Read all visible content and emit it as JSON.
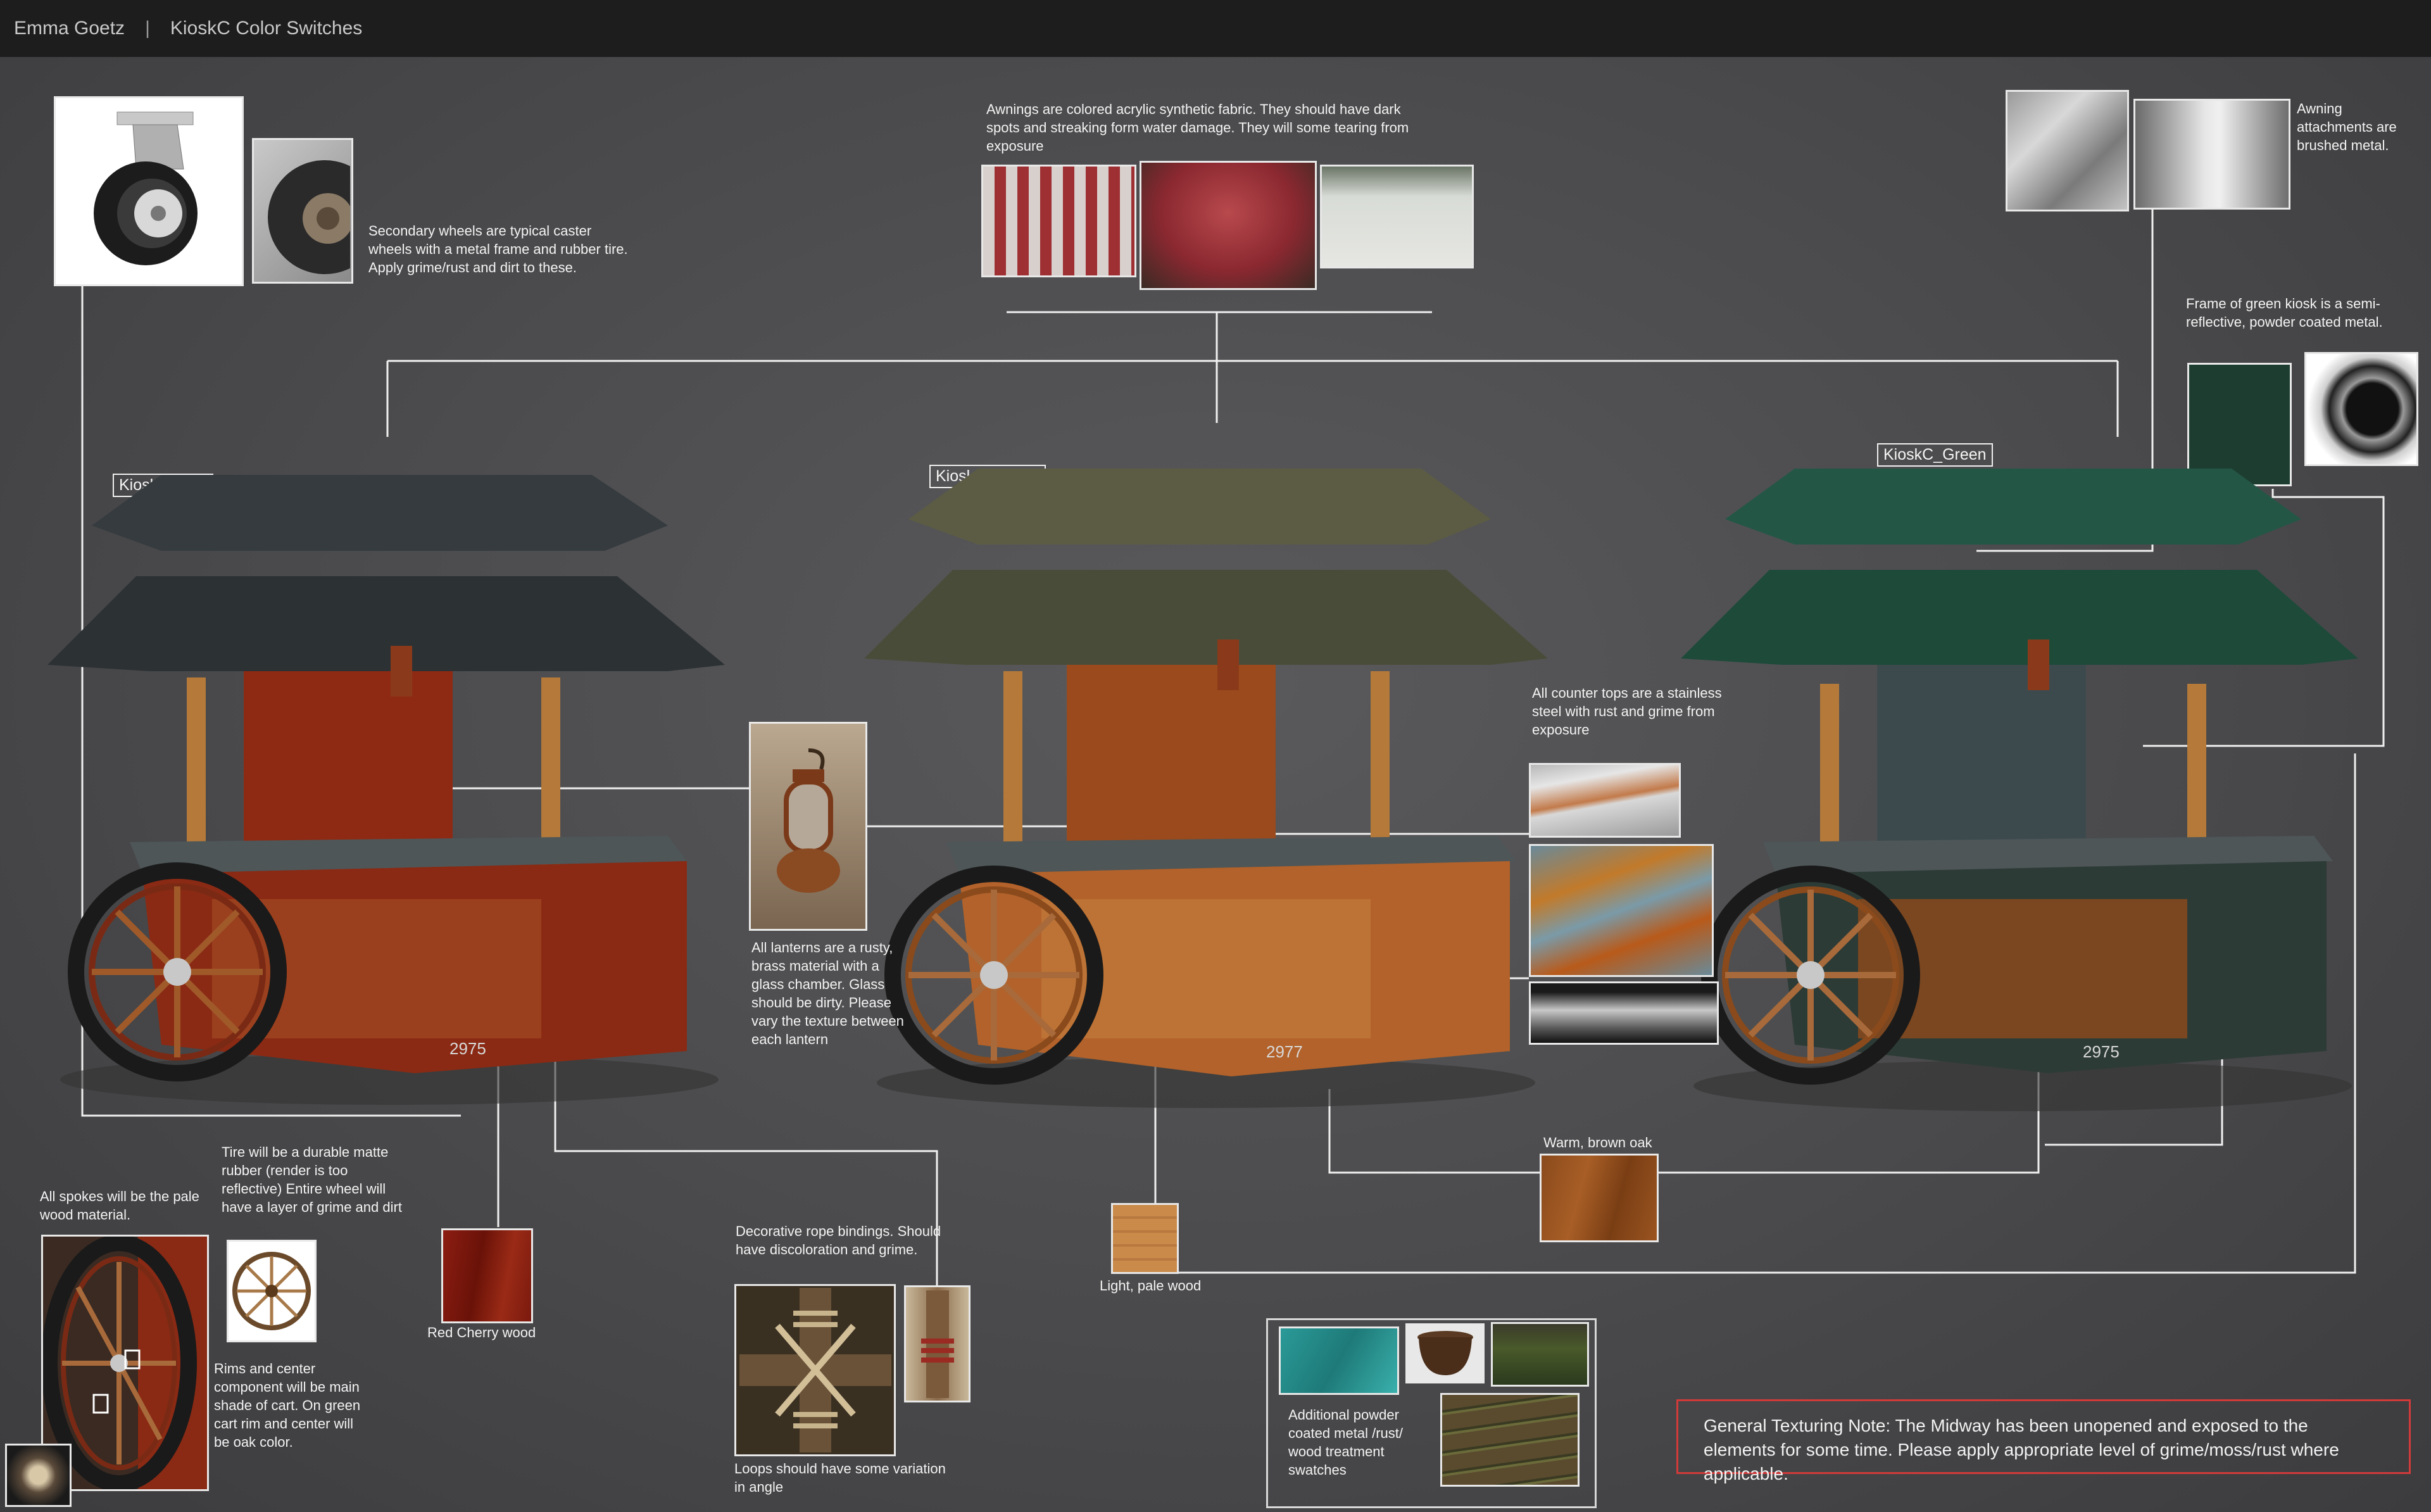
{
  "header": {
    "author": "Emma Goetz",
    "separator": "|",
    "title": "KioskC Color Switches"
  },
  "kiosks": {
    "red": {
      "label": "KioskC_Red",
      "serial": "2975",
      "wood_color": "#8e2a14",
      "roof_color": "#2c3134",
      "icon": "kiosk-red-render"
    },
    "brown": {
      "label": "KioskC_Brown",
      "serial": "2977",
      "wood_color": "#9a4a1c",
      "roof_color": "#4a4c3a",
      "icon": "kiosk-brown-render"
    },
    "green": {
      "label": "KioskC_Green",
      "serial": "2975",
      "wood_color": "#7a3e1a",
      "roof_color": "#1e4a3a",
      "icon": "kiosk-green-render"
    }
  },
  "notes": {
    "wheels": "Secondary wheels are typical caster wheels with a metal frame and rubber tire. Apply grime/rust and dirt to these.",
    "awnings": "Awnings are colored acrylic synthetic fabric. They should have dark spots and streaking form water damage. They will some tearing from exposure",
    "awning_attachments": "Awning attachments are brushed metal.",
    "green_frame": "Frame of green kiosk is a semi-reflective, powder coated metal.",
    "counter_tops": "All counter tops are a stainless steel with rust and grime from exposure",
    "lanterns": "All lanterns are a rusty, brass material with a glass chamber. Glass should be dirty. Please vary the texture between each lantern",
    "tire": "Tire will be a durable matte rubber (render is too reflective) Entire wheel will have a layer of grime and dirt",
    "spokes": "All spokes will be the pale wood material.",
    "rims": "Rims and center component will be main shade of cart. On green cart rim and center will be oak color.",
    "rope": "Decorative rope bindings. Should have discoloration and grime.",
    "rope_loops": "Loops should have some variation in angle",
    "red_cherry": "Red Cherry wood",
    "pale_wood": "Light, pale wood",
    "brown_oak": "Warm, brown oak",
    "palette": "Additional powder coated metal /rust/ wood treatment swatches",
    "general": "General Texturing Note: The Midway has been unopened and exposed to the elements for some time. Please apply appropriate level of grime/moss/rust where applicable."
  },
  "colors": {
    "red_cherry": "#8c1d12",
    "pale_wood": "#c98a4a",
    "brown_oak": "#8a4a1c",
    "green_metal": "#1d3d30",
    "teal_paint": "#2a9a98",
    "note_border": "#d23a3a"
  },
  "icons": {
    "caster": "caster-wheel-photo",
    "tire": "rusty-tire-photo",
    "brushed_metal": "brushed-metal-swatch",
    "lantern": "lantern-photo",
    "rope": "rope-binding-photo",
    "wagon_wheel": "wagon-wheel-photo"
  }
}
